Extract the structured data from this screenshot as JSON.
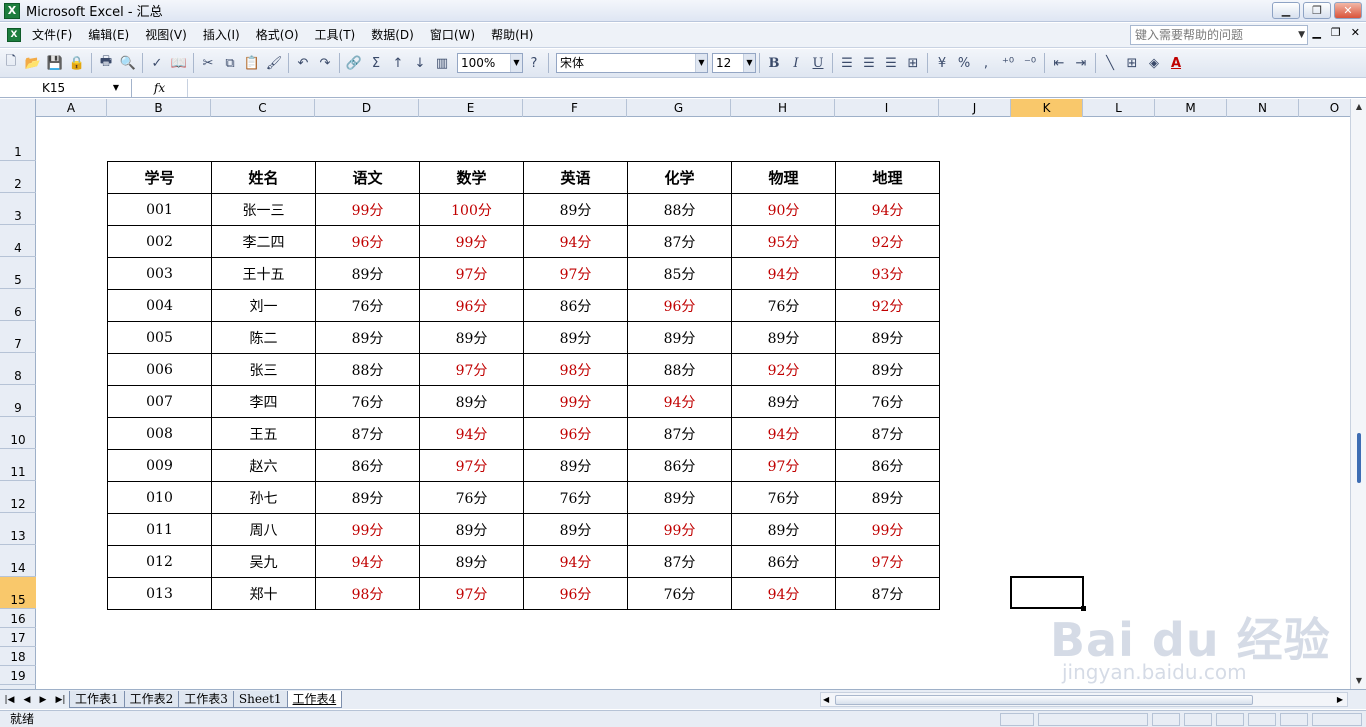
{
  "window": {
    "title": "Microsoft Excel - 汇总",
    "app_icon": "X"
  },
  "menu": {
    "items": [
      "文件(F)",
      "编辑(E)",
      "视图(V)",
      "插入(I)",
      "格式(O)",
      "工具(T)",
      "数据(D)",
      "窗口(W)",
      "帮助(H)"
    ],
    "help_placeholder": "键入需要帮助的问题"
  },
  "toolbar": {
    "zoom": "100%",
    "font_name": "宋体",
    "font_size": "12",
    "bold": "B",
    "italic": "I",
    "underline": "U",
    "percent": "%",
    "comma": ","
  },
  "formula_bar": {
    "name_box": "K15",
    "fx": "fx",
    "content": ""
  },
  "columns": [
    "A",
    "B",
    "C",
    "D",
    "E",
    "F",
    "G",
    "H",
    "I",
    "J",
    "K",
    "L",
    "M",
    "N",
    "O"
  ],
  "rows": [
    "1",
    "2",
    "3",
    "4",
    "5",
    "6",
    "7",
    "8",
    "9",
    "10",
    "11",
    "12",
    "13",
    "14",
    "15",
    "16",
    "17",
    "18",
    "19"
  ],
  "active_cell": {
    "column": "K",
    "row": "15"
  },
  "table": {
    "headers": [
      "学号",
      "姓名",
      "语文",
      "数学",
      "英语",
      "化学",
      "物理",
      "地理"
    ],
    "rows": [
      [
        "001",
        "张一三",
        "99分",
        "100分",
        "89分",
        "88分",
        "90分",
        "94分"
      ],
      [
        "002",
        "李二四",
        "96分",
        "99分",
        "94分",
        "87分",
        "95分",
        "92分"
      ],
      [
        "003",
        "王十五",
        "89分",
        "97分",
        "97分",
        "85分",
        "94分",
        "93分"
      ],
      [
        "004",
        "刘一",
        "76分",
        "96分",
        "86分",
        "96分",
        "76分",
        "92分"
      ],
      [
        "005",
        "陈二",
        "89分",
        "89分",
        "89分",
        "89分",
        "89分",
        "89分"
      ],
      [
        "006",
        "张三",
        "88分",
        "97分",
        "98分",
        "88分",
        "92分",
        "89分"
      ],
      [
        "007",
        "李四",
        "76分",
        "89分",
        "99分",
        "94分",
        "89分",
        "76分"
      ],
      [
        "008",
        "王五",
        "87分",
        "94分",
        "96分",
        "87分",
        "94分",
        "87分"
      ],
      [
        "009",
        "赵六",
        "86分",
        "97分",
        "89分",
        "86分",
        "97分",
        "86分"
      ],
      [
        "010",
        "孙七",
        "89分",
        "76分",
        "76分",
        "89分",
        "76分",
        "89分"
      ],
      [
        "011",
        "周八",
        "99分",
        "89分",
        "89分",
        "99分",
        "89分",
        "99分"
      ],
      [
        "012",
        "吴九",
        "94分",
        "89分",
        "94分",
        "87分",
        "86分",
        "97分"
      ],
      [
        "013",
        "郑十",
        "98分",
        "97分",
        "96分",
        "76分",
        "94分",
        "87分"
      ]
    ],
    "highlight_threshold": 90,
    "highlight_color": "#c00000"
  },
  "sheet_tabs": [
    "工作表1",
    "工作表2",
    "工作表3",
    "Sheet1",
    "工作表4"
  ],
  "active_sheet": "工作表4",
  "status": {
    "text": "就绪"
  },
  "watermark": {
    "main": "Bai du 经验",
    "sub": "jingyan.baidu.com"
  }
}
